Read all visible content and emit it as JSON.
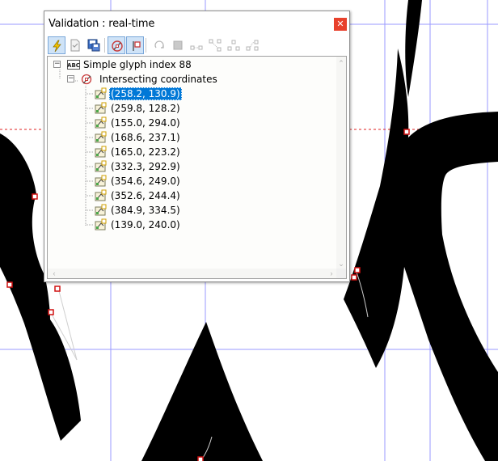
{
  "window": {
    "title": "Validation : real-time",
    "close_glyph": "✕"
  },
  "toolbar": {
    "buttons": [
      {
        "name": "realtime-validation-button",
        "icon": "lightning-icon",
        "active": true
      },
      {
        "name": "document-check-button",
        "icon": "document-icon",
        "active": false
      },
      {
        "name": "save-report-button",
        "icon": "floppy-icon",
        "active": false
      },
      {
        "name": "intersection-check-button",
        "icon": "target-icon",
        "active": true
      },
      {
        "name": "point-check-button",
        "icon": "point-marker-icon",
        "active": true
      },
      {
        "name": "direction-check-button",
        "icon": "rotate-icon",
        "active": false
      },
      {
        "name": "square-check-button",
        "icon": "square-icon",
        "active": false
      },
      {
        "name": "nodes-check-button",
        "icon": "nodes-icon",
        "active": false
      },
      {
        "name": "tangent-check-button",
        "icon": "tangent-icon",
        "active": false
      },
      {
        "name": "extremum-check-button",
        "icon": "extremum-icon",
        "active": false
      },
      {
        "name": "curve-check-button",
        "icon": "curve-nodes-icon",
        "active": false
      }
    ]
  },
  "tree": {
    "root": {
      "label": "Simple glyph index 88",
      "icon": "abc-glyph-icon",
      "expander": "−"
    },
    "group": {
      "label": "Intersecting coordinates",
      "icon": "intersection-icon",
      "expander": "−"
    },
    "items": [
      {
        "label": "(258.2, 130.9)",
        "selected": true
      },
      {
        "label": "(259.8, 128.2)"
      },
      {
        "label": "(155.0, 294.0)"
      },
      {
        "label": "(168.6, 237.1)"
      },
      {
        "label": "(165.0, 223.2)"
      },
      {
        "label": "(332.3, 292.9)"
      },
      {
        "label": "(354.6, 249.0)"
      },
      {
        "label": "(352.6, 244.4)"
      },
      {
        "label": "(384.9, 334.5)"
      },
      {
        "label": "(139.0, 240.0)"
      }
    ],
    "item_icon": "coordinate-node-icon"
  },
  "colors": {
    "glyph": "#000000",
    "grid": "#8c8cff",
    "baseline": "#e02020",
    "selection": "#0078d7",
    "close": "#e8412c"
  }
}
